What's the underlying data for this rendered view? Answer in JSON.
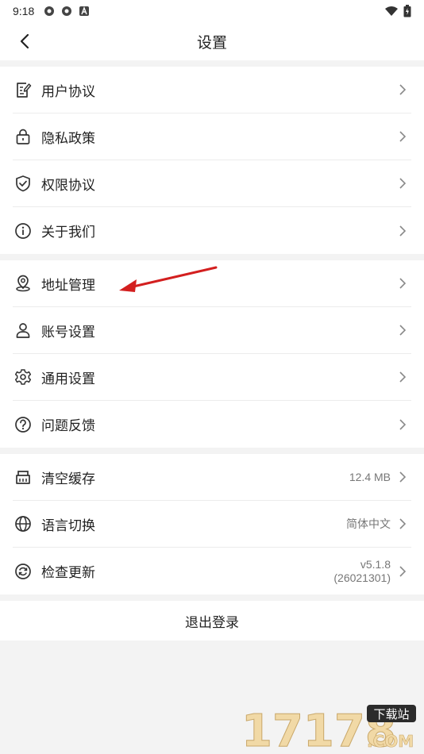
{
  "status_bar": {
    "time": "9:18"
  },
  "header": {
    "title": "设置"
  },
  "group1": [
    {
      "name": "user-agreement",
      "icon": "document-edit-icon",
      "label": "用户协议"
    },
    {
      "name": "privacy-policy",
      "icon": "lock-icon",
      "label": "隐私政策"
    },
    {
      "name": "permission-agreement",
      "icon": "shield-check-icon",
      "label": "权限协议"
    },
    {
      "name": "about-us",
      "icon": "info-icon",
      "label": "关于我们"
    }
  ],
  "group2": [
    {
      "name": "address-management",
      "icon": "location-pin-icon",
      "label": "地址管理"
    },
    {
      "name": "account-settings",
      "icon": "user-icon",
      "label": "账号设置"
    },
    {
      "name": "general-settings",
      "icon": "gear-icon",
      "label": "通用设置"
    },
    {
      "name": "feedback",
      "icon": "question-icon",
      "label": "问题反馈"
    }
  ],
  "group3": [
    {
      "name": "clear-cache",
      "icon": "basket-icon",
      "label": "清空缓存",
      "value": "12.4 MB"
    },
    {
      "name": "language-switch",
      "icon": "globe-icon",
      "label": "语言切换",
      "value": "简体中文"
    },
    {
      "name": "check-update",
      "icon": "refresh-icon",
      "label": "检查更新",
      "value": "v5.1.8",
      "value2": "(26021301)"
    }
  ],
  "logout_label": "退出登录",
  "annotation_color": "#d31f1f",
  "watermark": {
    "brand": "17178",
    "badge": "下载站",
    "suffix": ".COM"
  }
}
